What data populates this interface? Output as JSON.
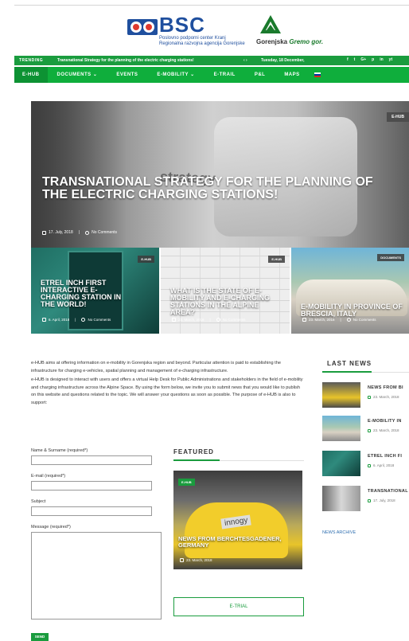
{
  "header": {
    "bsc_logo_text": "BSC",
    "bsc_sub1": "Poslovno podporni center Kranj",
    "bsc_sub2": "Regionalna razvojna agencija Gorenjske",
    "gorenjska_logo_text": "Gorenjska",
    "gorenjska_logo_tag": "Gremo gor."
  },
  "trending": {
    "label": "TRENDING",
    "text": "Transnational Strategy for the planning of the electric charging stations!",
    "arrows": "‹ ›",
    "date": "Tuesday, 18 December,",
    "social": [
      "f",
      "t",
      "G+",
      "p",
      "in",
      "yt"
    ]
  },
  "nav": {
    "items": [
      "E-HUB",
      "DOCUMENTS ⌄",
      "EVENTS",
      "E-MOBILITY ⌄",
      "E-TRAIL",
      "P&L",
      "MAPS"
    ]
  },
  "hero": {
    "image_word": "strategy",
    "tag": "E-HUB",
    "title": "TRANSNATIONAL STRATEGY FOR THE PLANNING OF THE ELECTRIC CHARGING STATIONS!",
    "date": "17. July, 2018",
    "comments": "No Comments"
  },
  "cards": [
    {
      "tag": "E-HUB",
      "title": "ETREL INCH FIRST INTERACTIVE E-CHARGING STATION IN THE WORLD!",
      "date": "6. April, 2018",
      "comments": "No Comments"
    },
    {
      "tag": "E-HUB",
      "title": "WHAT IS THE STATE OF E-MOBILITY AND E-CHARGING STATIONS IN THE ALPINE AREA?",
      "date": "23. March, 2018",
      "comments": "No Comments"
    },
    {
      "tag": "DOCUMENTS",
      "title": "E-MOBILITY IN PROVINCE OF BRESCIA, ITALY",
      "date": "23. March, 2018",
      "comments": "No Comments"
    }
  ],
  "intro": {
    "p1": "e-HUB aims at offering information on e-mobility in Gorenjska region and beyond. Particular attention is paid to establishing the infrastructure for charging e-vehicles, spatial planning and management of e-charging infrastructure.",
    "p2": "e-HUB is designed to interact with users and offers a virtual Help Desk for Public Administrations and stakeholders in the field of e-mobility and charging infrastructure across the Alpine Space. By using the form below, we invite you to submit news that you would like to publish on this website and questions related to the topic. We will answer your questions as soon as possible. The purpose of e-HUB is also to support:"
  },
  "form": {
    "name_label": "Name & Surname (required*)",
    "email_label": "E-mail (required*)",
    "subject_label": "Subject",
    "message_label": "Message (required*)",
    "send_label": "SEND"
  },
  "featured": {
    "heading": "FEATURED",
    "tag": "E-HUB",
    "image_brand": "innogy",
    "title": "NEWS FROM BERCHTESGADENER, GERMANY",
    "date": "23. March, 2018",
    "etrial_label": "E-TRIAL"
  },
  "last_news": {
    "heading": "LAST NEWS",
    "items": [
      {
        "title": "NEWS FROM BI",
        "date": "23. March, 2018"
      },
      {
        "title": "E-MOBILITY IN",
        "date": "23. March, 2018"
      },
      {
        "title": "ETREL INCH FI",
        "date": "6. April, 2018"
      },
      {
        "title": "TRANSNATIONAL",
        "date": "17. July, 2018"
      }
    ],
    "archive_label": "NEWS ARCHIVE"
  },
  "colors": {
    "accent_green": "#1a9c3e",
    "nav_green": "#0fae3c",
    "bsc_blue": "#1f4f9e"
  }
}
